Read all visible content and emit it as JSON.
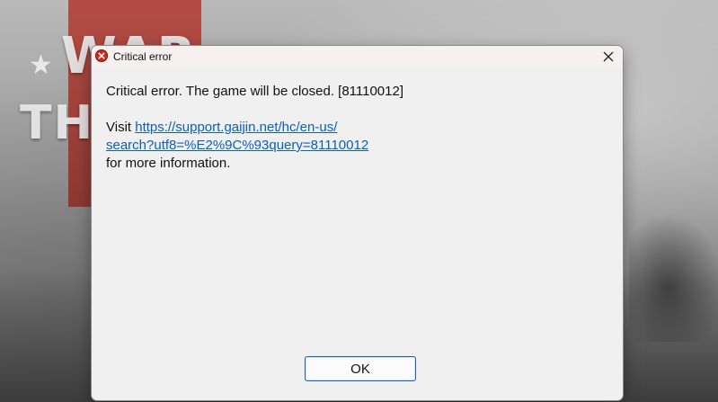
{
  "background": {
    "logo_line1": "WAR",
    "logo_line2": "THUNDER",
    "star_icon": "star-icon"
  },
  "dialog": {
    "title": "Critical error",
    "title_icon": "error-icon",
    "close_icon": "close-icon",
    "message": "Critical error. The game will be closed. [81110012]",
    "visit_prefix": "Visit ",
    "link_line1": "https://support.gaijin.net/hc/en-us/",
    "link_line2": "search?utf8=%E2%9C%93query=81110012",
    "suffix": "for more information.",
    "ok_label": "OK"
  },
  "colors": {
    "error_red": "#c42b1c",
    "link_blue": "#0a5fbf",
    "dialog_bg": "#f0f0f0",
    "button_border": "#1f5fb0"
  }
}
